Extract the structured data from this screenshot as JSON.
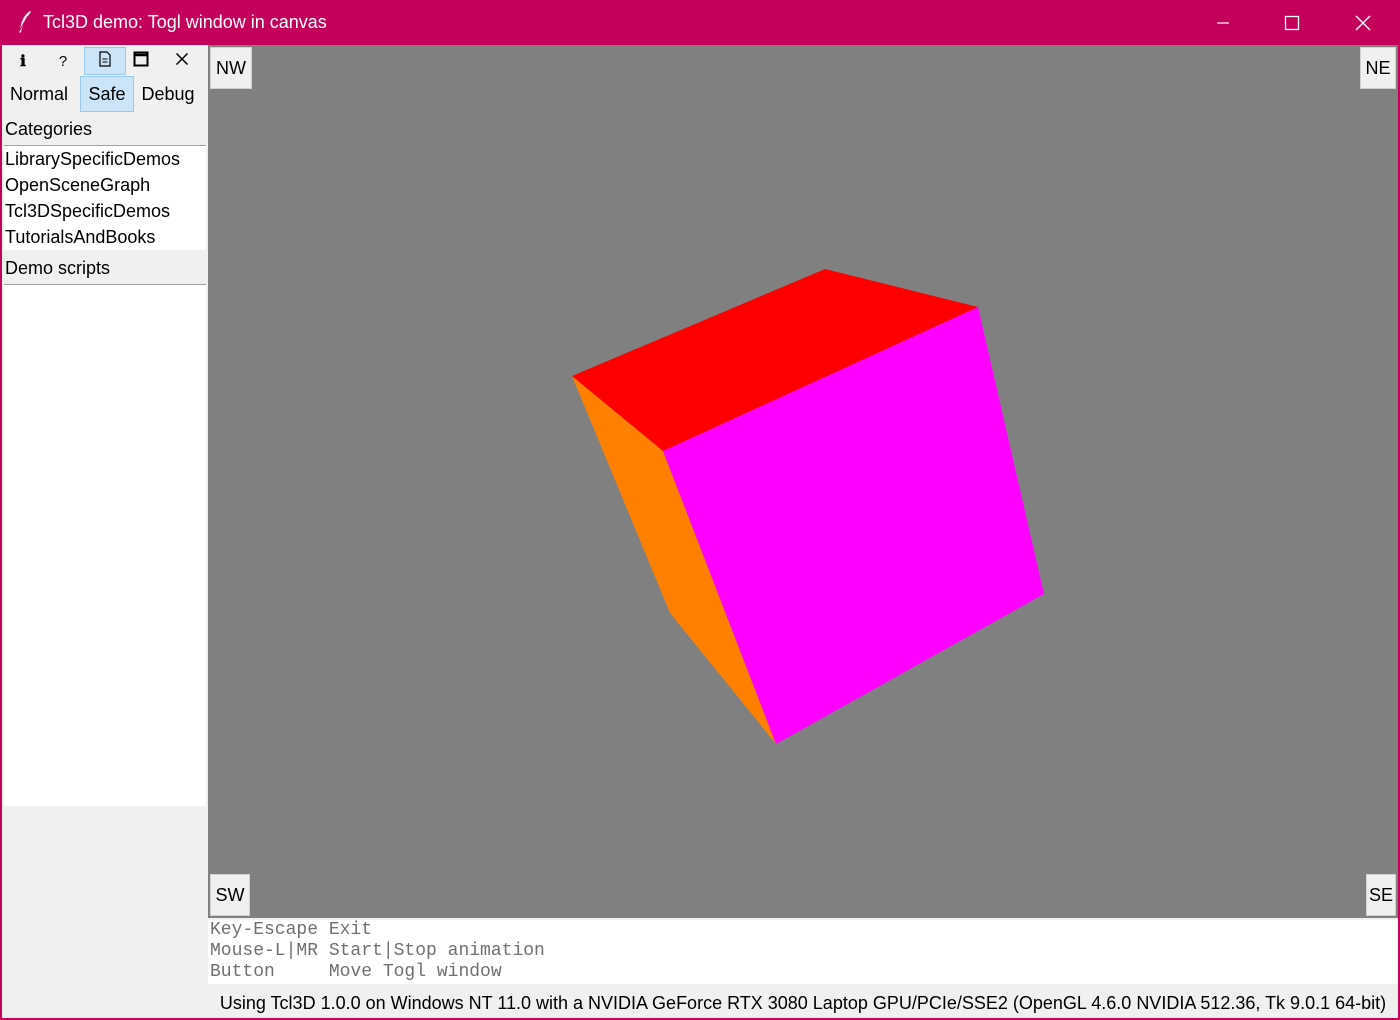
{
  "window": {
    "title": "Tcl3D demo: Togl window in canvas",
    "accent_color": "#c4005a"
  },
  "toolbar": {
    "buttons": [
      {
        "icon": "info-icon",
        "glyph": "ℹ"
      },
      {
        "icon": "help-icon",
        "glyph": "?"
      },
      {
        "icon": "document-icon",
        "glyph": "🗎"
      },
      {
        "icon": "window-icon",
        "glyph": "🗖"
      },
      {
        "icon": "close-icon",
        "glyph": "✕"
      }
    ]
  },
  "modes": {
    "normal": "Normal",
    "safe": "Safe",
    "debug": "Debug",
    "selected": "Safe"
  },
  "categories": {
    "label": "Categories",
    "items": [
      "LibrarySpecificDemos",
      "OpenSceneGraph",
      "Tcl3DSpecificDemos",
      "TutorialsAndBooks"
    ]
  },
  "demo_scripts": {
    "label": "Demo scripts",
    "items": []
  },
  "canvas": {
    "background": "#808080",
    "corners": {
      "nw": "NW",
      "ne": "NE",
      "sw": "SW",
      "se": "SE"
    },
    "cube_face_colors": {
      "top": "#ff0000",
      "front": "#ff00ff",
      "left": "#ff8000"
    }
  },
  "help": {
    "lines": [
      "Key-Escape Exit",
      "Mouse-L|MR Start|Stop animation",
      "Button     Move Togl window"
    ]
  },
  "status": "Using Tcl3D 1.0.0 on Windows NT 11.0 with a NVIDIA GeForce RTX 3080 Laptop GPU/PCIe/SSE2 (OpenGL 4.6.0 NVIDIA 512.36, Tk 9.0.1 64-bit)"
}
